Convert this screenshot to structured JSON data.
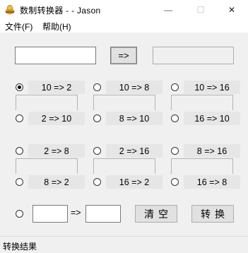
{
  "window": {
    "title": "数制转换器 - - Jason",
    "minimize_glyph": "—",
    "maximize_glyph": "☐",
    "close_glyph": "✕"
  },
  "menu": {
    "file": "文件(F)",
    "help": "帮助(H)"
  },
  "top_row": {
    "input_value": "",
    "convert_button": "=>",
    "output_value": ""
  },
  "radios": [
    {
      "label": "10 => 2",
      "checked": true
    },
    {
      "label": "10 => 8",
      "checked": false
    },
    {
      "label": "10 => 16",
      "checked": false
    },
    {
      "label": "2 => 10",
      "checked": false
    },
    {
      "label": "8 => 10",
      "checked": false
    },
    {
      "label": "16 => 10",
      "checked": false
    },
    {
      "label": "2 => 8",
      "checked": false
    },
    {
      "label": "2 => 16",
      "checked": false
    },
    {
      "label": "8 => 16",
      "checked": false
    },
    {
      "label": "8 => 2",
      "checked": false
    },
    {
      "label": "16 => 2",
      "checked": false
    },
    {
      "label": "16 => 8",
      "checked": false
    }
  ],
  "custom_row": {
    "from_value": "",
    "arrow": "=>",
    "to_value": "",
    "clear_button": "清空",
    "convert_button": "转换"
  },
  "status": {
    "text": "转换结果"
  },
  "colors": {
    "client_bg": "#f0f0f0",
    "label_bg": "#e6e6e6",
    "icon_accent": "#d9a13a"
  }
}
